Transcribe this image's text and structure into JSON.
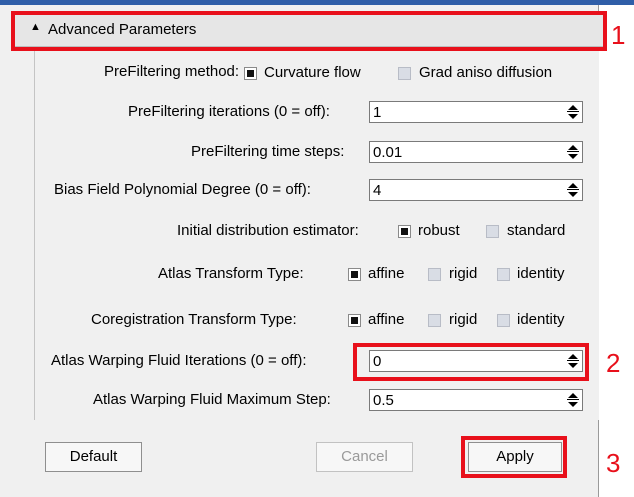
{
  "header": {
    "title": "Advanced Parameters",
    "collapse_icon": "triangle-up-icon"
  },
  "prefiltering_method": {
    "label": "PreFiltering method:",
    "options": [
      {
        "label": "Curvature flow",
        "checked": true
      },
      {
        "label": "Grad aniso diffusion",
        "checked": false
      }
    ]
  },
  "fields": [
    {
      "label": "PreFiltering iterations (0 = off):",
      "value": "1"
    },
    {
      "label": "PreFiltering time steps:",
      "value": "0.01"
    },
    {
      "label": "Bias Field Polynomial Degree (0 = off):",
      "value": "4"
    },
    {
      "label": "Atlas Warping Fluid Iterations (0 = off):",
      "value": "0"
    },
    {
      "label": "Atlas Warping Fluid Maximum Step:",
      "value": "0.5"
    }
  ],
  "initial_distribution": {
    "label": "Initial distribution estimator:",
    "options": [
      {
        "label": "robust",
        "checked": true
      },
      {
        "label": "standard",
        "checked": false
      }
    ]
  },
  "atlas_transform": {
    "label": "Atlas Transform Type:",
    "options": [
      {
        "label": "affine",
        "checked": true
      },
      {
        "label": "rigid",
        "checked": false
      },
      {
        "label": "identity",
        "checked": false
      }
    ]
  },
  "coregistration_transform": {
    "label": "Coregistration Transform Type:",
    "options": [
      {
        "label": "affine",
        "checked": true
      },
      {
        "label": "rigid",
        "checked": false
      },
      {
        "label": "identity",
        "checked": false
      }
    ]
  },
  "buttons": {
    "default": "Default",
    "cancel": "Cancel",
    "apply": "Apply"
  },
  "callouts": [
    "1",
    "2",
    "3"
  ],
  "colors": {
    "annotation_red": "#e8101b",
    "top_bar": "#2f5ea8",
    "panel_bg": "#f0f0f0"
  }
}
